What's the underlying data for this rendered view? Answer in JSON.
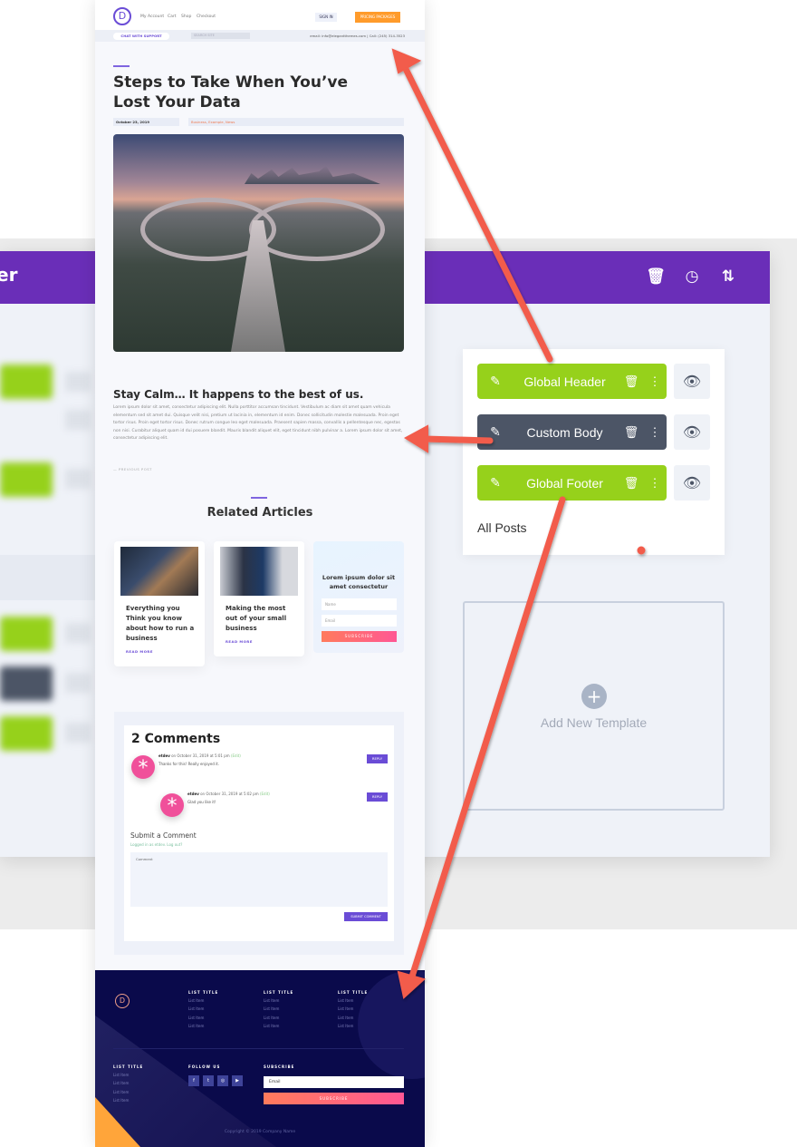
{
  "builder": {
    "title_fragment": "er",
    "header_icons": [
      "trash-icon",
      "history-icon",
      "sort-icon"
    ],
    "templates": [
      {
        "label": "Global Header",
        "color": "#96d11b"
      },
      {
        "label": "Custom Body",
        "color": "#4c5566"
      },
      {
        "label": "Global Footer",
        "color": "#96d11b"
      }
    ],
    "assignment": "All Posts",
    "add_new": "Add New Template",
    "accent": "#6a2eb8"
  },
  "site": {
    "logo": "D",
    "nav": [
      "My Account",
      "Cart",
      "Shop",
      "Checkout"
    ],
    "sign_in": "SIGN IN",
    "pricing": "PRICING PACKAGES",
    "chat": "CHAT WITH SUPPORT",
    "search_placeholder": "SEARCH SITE",
    "contact": "email: info@elegantthemes.com  |  Call: (245) 314-3523",
    "title": "Steps to Take When You’ve Lost Your Data",
    "date": "October 23, 2019",
    "categories": "Business, Example, News",
    "subheading": "Stay Calm… It happens to the best of us.",
    "paragraph": "Lorem ipsum dolor sit amet, consectetur adipiscing elit. Nulla porttitor accumsan tincidunt. Vestibulum ac diam sit amet quam vehicula elementum sed sit amet dui. Quisque velit nisi, pretium ut lacinia in, elementum id enim. Donec sollicitudin molestie malesuada. Proin eget tortor risus. Proin eget tortor risus. Donec rutrum congue leo eget malesuada. Praesent sapien massa, convallis a pellentesque nec, egestas non nisi. Curabitur aliquet quam id dui posuere blandit. Mauris blandit aliquet elit, eget tincidunt nibh pulvinar a. Lorem ipsum dolor sit amet, consectetur adipiscing elit.",
    "prev_post": "— PREVIOUS POST",
    "related_title": "Related Articles",
    "related": [
      {
        "title": "Everything you Think you know about how to run a business",
        "more": "READ MORE"
      },
      {
        "title": "Making the most out of your small business",
        "more": "READ MORE"
      }
    ],
    "subscribe_card": {
      "title": "Lorem ipsum dolor sit amet consectetur",
      "name_placeholder": "Name",
      "email_placeholder": "Email",
      "button": "SUBSCRIBE"
    },
    "comments": {
      "heading": "2 Comments",
      "items": [
        {
          "author": "etdev",
          "meta": " on October 31, 2019 at 5:01 pm",
          "edit": "(Edit)",
          "text": "Thanks for this! Really enjoyed it.",
          "reply": "REPLY"
        },
        {
          "author": "etdev",
          "meta": " on October 31, 2019 at 5:02 pm",
          "edit": "(Edit)",
          "text": "Glad you like it!",
          "reply": "REPLY"
        }
      ],
      "submit_heading": "Submit a Comment",
      "logged_in": "Logged in as etdev. Log out?",
      "comment_placeholder": "Comment",
      "submit": "SUBMIT COMMENT"
    },
    "footer": {
      "columns": [
        {
          "title": "LIST TITLE",
          "items": [
            "List Item",
            "List Item",
            "List Item",
            "List Item"
          ]
        },
        {
          "title": "LIST TITLE",
          "items": [
            "List Item",
            "List Item",
            "List Item",
            "List Item"
          ]
        },
        {
          "title": "LIST TITLE",
          "items": [
            "List Item",
            "List Item",
            "List Item",
            "List Item"
          ]
        },
        {
          "title": "LIST TITLE",
          "items": [
            "List Item",
            "List Item",
            "List Item",
            "List Item"
          ]
        }
      ],
      "follow": "FOLLOW US",
      "social": [
        "f",
        "t",
        "◎",
        "▶"
      ],
      "subscribe": "SUBSCRIBE",
      "email_placeholder": "Email",
      "subscribe_button": "SUBSCRIBE",
      "copyright": "Copyright © 2019 Company Name"
    }
  },
  "arrow_color": "#f25b4b"
}
